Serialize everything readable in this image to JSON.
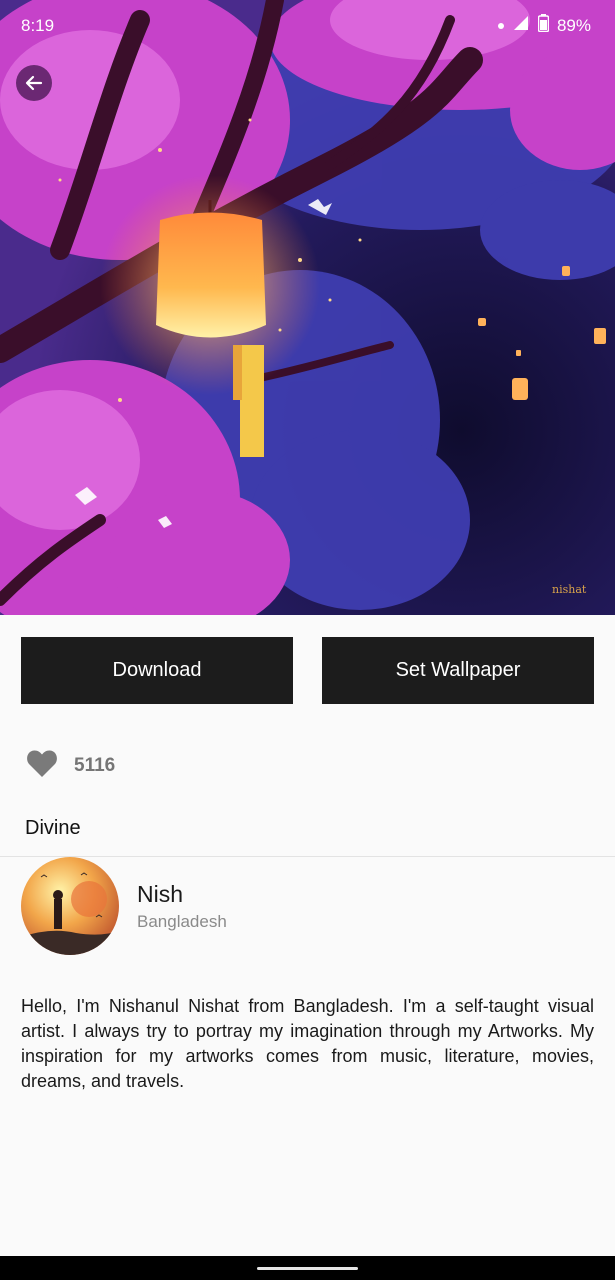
{
  "status_bar": {
    "time": "8:19",
    "battery": "89%",
    "icons": [
      "notification-dot-icon",
      "signal-icon",
      "battery-icon"
    ]
  },
  "header": {
    "back_icon": "arrow-left-icon"
  },
  "artwork": {
    "watermark": "nishat",
    "colors": {
      "sky": "#1a1138",
      "foliage_pink": "#c445c8",
      "foliage_blue": "#3d3aa8",
      "lantern": "#ffb24a"
    }
  },
  "actions": {
    "download_label": "Download",
    "set_wallpaper_label": "Set Wallpaper"
  },
  "likes": {
    "icon": "heart-icon",
    "count": "5116"
  },
  "wallpaper": {
    "title": "Divine"
  },
  "author": {
    "name": "Nish",
    "location": "Bangladesh",
    "bio": "Hello, I'm Nishanul Nishat from Bangladesh. I'm a self-taught visual artist. I always try to portray my imagination through my Artworks. My inspiration for my artworks comes from music, literature, movies, dreams, and travels."
  }
}
